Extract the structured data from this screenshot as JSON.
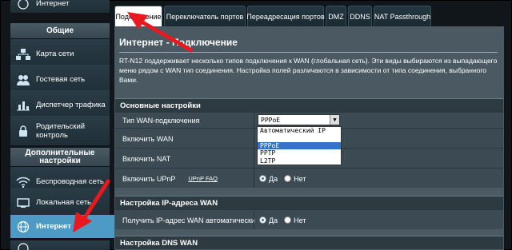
{
  "sidebar": {
    "top_item": "Интернет",
    "general_header": "Общие",
    "general_items": [
      {
        "label": "Карта сети",
        "icon": "network-map-icon"
      },
      {
        "label": "Гостевая сеть",
        "icon": "guest-network-icon"
      },
      {
        "label": "Диспетчер трафика",
        "icon": "traffic-manager-icon"
      },
      {
        "label": "Родительский контроль",
        "icon": "parental-control-icon"
      }
    ],
    "advanced_header": "Дополнительные настройки",
    "advanced_items": [
      {
        "label": "Беспроводная сеть",
        "icon": "wifi-icon"
      },
      {
        "label": "Локальная сеть",
        "icon": "lan-icon"
      },
      {
        "label": "Интернет",
        "icon": "globe-icon"
      }
    ]
  },
  "tabs": [
    {
      "label": "Подключение"
    },
    {
      "label": "Переключатель портов"
    },
    {
      "label": "Переадресация портов"
    },
    {
      "label": "DMZ"
    },
    {
      "label": "DDNS"
    },
    {
      "label": "NAT Passthrough"
    }
  ],
  "page": {
    "title": "Интернет - Подключение",
    "description": "RT-N12   поддерживает несколько типов подключения к WAN (глобальная сеть). Эти виды выбираются из выпадающего меню рядом с WAN тип соединения. Настройка полей различаются в зависимости от типа соединения, выбранного Вами."
  },
  "basic": {
    "header": "Основные настройки",
    "wan_type_label": "Тип WAN-подключения",
    "wan_type_value": "PPPoE",
    "enable_wan_label": "Включить WAN",
    "enable_nat_label": "Включить NAT",
    "enable_upnp_label": "Включить UPnP",
    "upnp_faq": "UPnP FAQ",
    "yes": "Да",
    "no": "Нет"
  },
  "dropdown": {
    "options": [
      "Автоматический IP",
      "PPPoE",
      "PPTP",
      "L2TP"
    ],
    "selected": "PPPoE"
  },
  "ip_section": {
    "header": "Настройка IP-адреса WAN",
    "auto_ip_label": "Получить IP-адрес WAN автоматически",
    "yes": "Да",
    "no": "Нет"
  },
  "dns_section": {
    "header": "Настройка DNS WAN"
  },
  "colors": {
    "accent": "#4d9ac4",
    "annotation_arrow": "#e8191f"
  }
}
